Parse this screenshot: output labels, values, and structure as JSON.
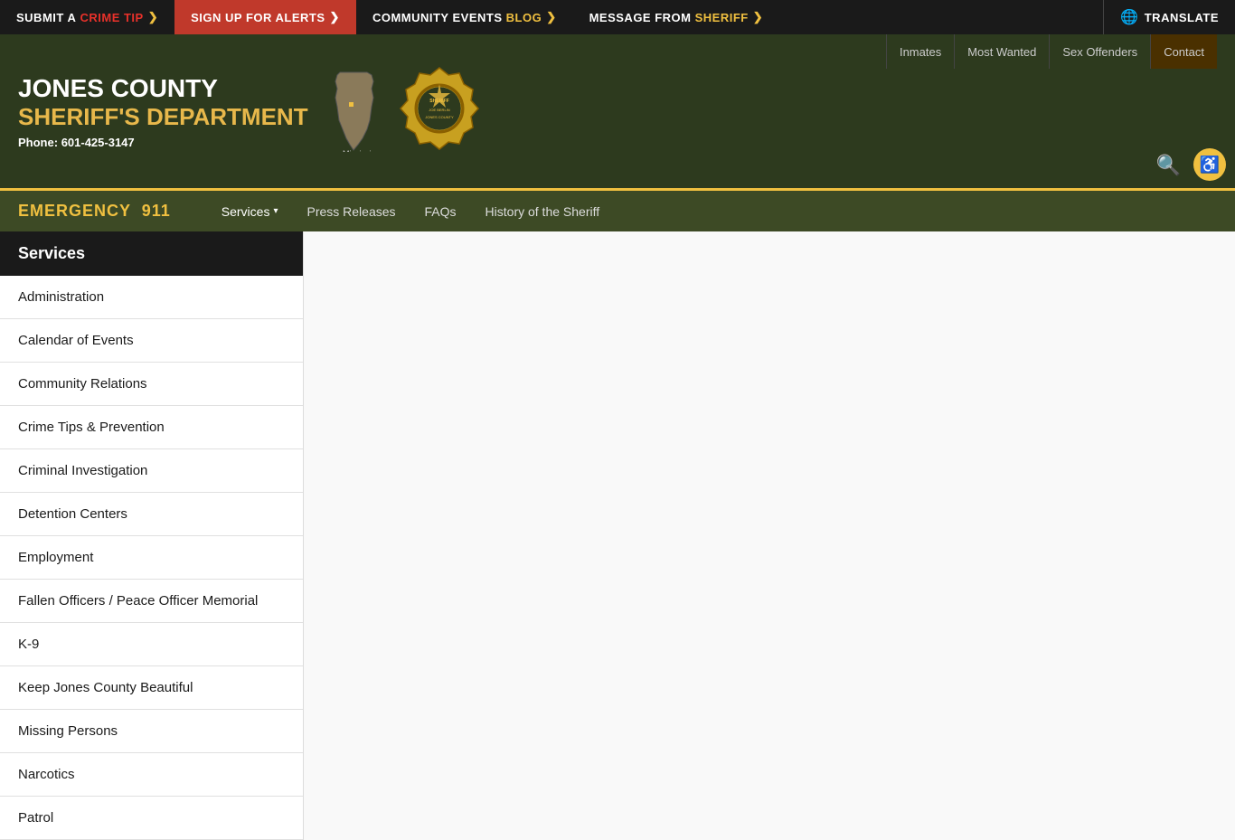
{
  "topBar": {
    "submit_label": "SUBMIT A",
    "crime_tip": "CRIME TIP",
    "arrow1": "❯",
    "signup_label": "SIGN UP FOR ALERTS",
    "arrow2": "❯",
    "community_label": "Community Events",
    "blog": "BLOG",
    "arrow3": "❯",
    "message_label": "Message From",
    "sheriff": "SHERIFF",
    "arrow4": "❯",
    "translate": "Translate"
  },
  "header": {
    "county": "JONES COUNTY",
    "dept": "SHERIFF'S DEPARTMENT",
    "phone_label": "Phone:",
    "phone": "601-425-3147",
    "state": "Mississippi",
    "topLinks": [
      {
        "label": "Inmates"
      },
      {
        "label": "Most Wanted"
      },
      {
        "label": "Sex Offenders"
      },
      {
        "label": "Contact"
      }
    ]
  },
  "nav": {
    "emergency": "EMERGENCY",
    "emergency_num": "911",
    "items": [
      {
        "label": "Services",
        "hasDropdown": true
      },
      {
        "label": "Press Releases"
      },
      {
        "label": "FAQs"
      },
      {
        "label": "History of the Sheriff"
      }
    ]
  },
  "sidebar": {
    "header": "Services",
    "items": [
      {
        "label": "Administration"
      },
      {
        "label": "Calendar of Events"
      },
      {
        "label": "Community Relations"
      },
      {
        "label": "Crime Tips & Prevention"
      },
      {
        "label": "Criminal Investigation"
      },
      {
        "label": "Detention Centers"
      },
      {
        "label": "Employment"
      },
      {
        "label": "Fallen Officers / Peace Officer Memorial"
      },
      {
        "label": "K-9"
      },
      {
        "label": "Keep Jones County Beautiful"
      },
      {
        "label": "Missing Persons"
      },
      {
        "label": "Narcotics"
      },
      {
        "label": "Patrol"
      }
    ]
  },
  "icons": {
    "search": "&#128269;",
    "globe": "&#127760;",
    "accessibility": "&#9855;"
  }
}
